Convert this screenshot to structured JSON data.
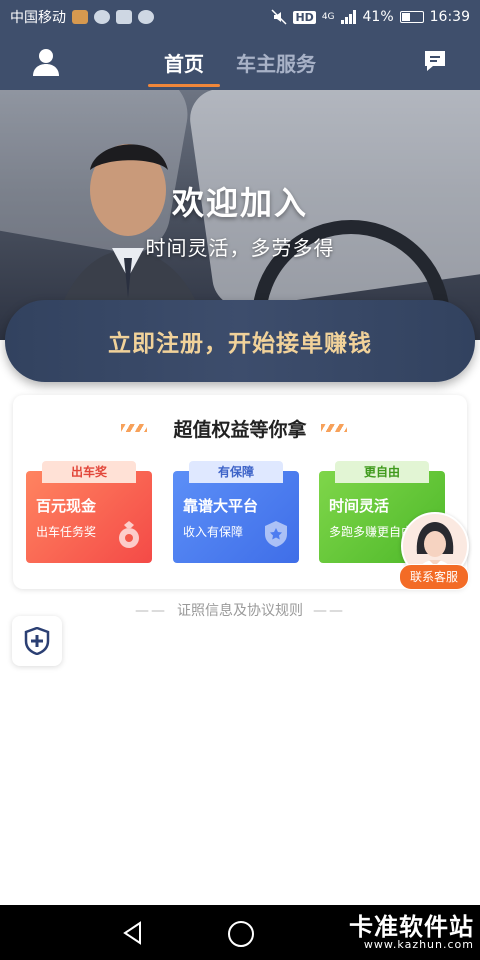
{
  "status_bar": {
    "carrier": "中国移动",
    "network": "4G",
    "hd": "HD",
    "battery_percent": "41%",
    "time": "16:39"
  },
  "header": {
    "tabs": [
      {
        "label": "首页",
        "active": true
      },
      {
        "label": "车主服务",
        "active": false
      }
    ],
    "user_icon": "user-icon",
    "message_icon": "message-icon"
  },
  "hero": {
    "title": "欢迎加入",
    "subtitle": "时间灵活，多劳多得"
  },
  "register_button": {
    "label": "立即注册，开始接单赚钱"
  },
  "benefits": {
    "title": "超值权益等你拿",
    "cards": [
      {
        "tag": "出车奖",
        "name": "百元现金",
        "desc": "出车任务奖",
        "color": "#f44a47",
        "icon": "money-bag-icon"
      },
      {
        "tag": "有保障",
        "name": "靠谱大平台",
        "desc": "收入有保障",
        "color": "#3f6ee8",
        "icon": "shield-star-icon"
      },
      {
        "tag": "更自由",
        "name": "时间灵活",
        "desc": "多跑多赚更自由",
        "color": "#4db829",
        "icon": "clock-icon"
      }
    ]
  },
  "customer_service": {
    "label": "联系客服"
  },
  "footer": {
    "link": "证照信息及协议规则",
    "dash": "——"
  },
  "watermark": {
    "main": "卡准软件站",
    "url": "www.kazhun.com"
  },
  "colors": {
    "header_bg": "#3f4f6c",
    "accent": "#f0873a",
    "register_text": "#f1d29a"
  }
}
